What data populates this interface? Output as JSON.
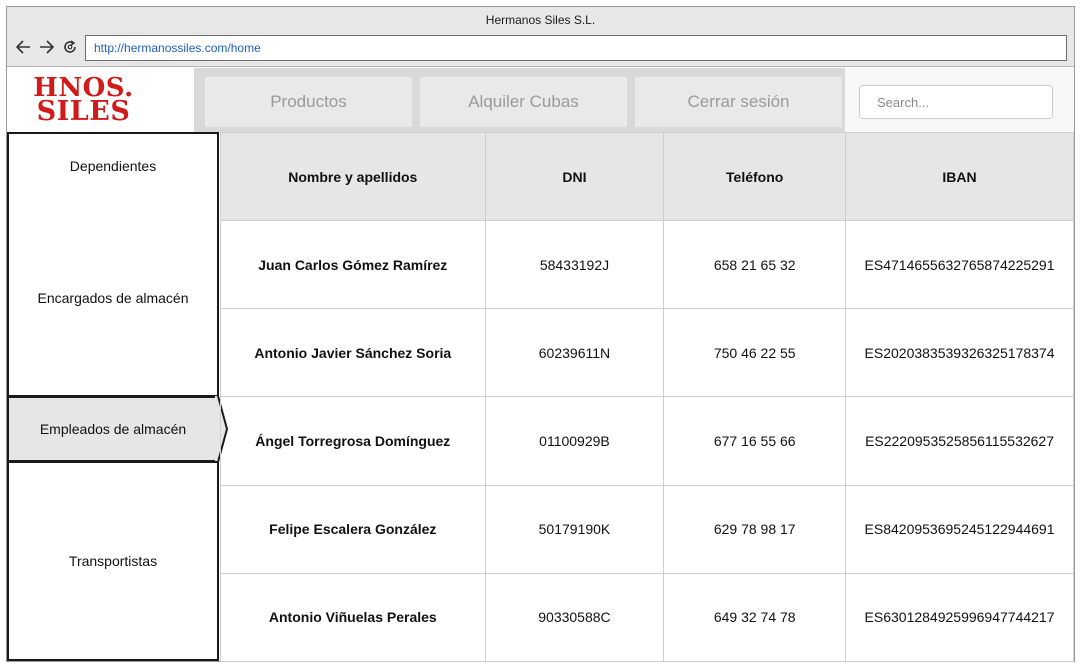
{
  "window": {
    "title": "Hermanos Siles S.L.",
    "url": "http://hermanossiles.com/home"
  },
  "logo": {
    "line1": "HNOS.",
    "line2": "SILES"
  },
  "nav": {
    "items": [
      {
        "label": "Productos"
      },
      {
        "label": "Alquiler Cubas"
      },
      {
        "label": "Cerrar sesión"
      }
    ]
  },
  "search": {
    "placeholder": "Search..."
  },
  "sidebar": {
    "items": [
      {
        "label": "Dependientes"
      },
      {
        "label": "Encargados de almacén"
      },
      {
        "label": "Empleados de almacén"
      },
      {
        "label": "Transportistas"
      }
    ],
    "active": "Empleados de almacén"
  },
  "table": {
    "headers": [
      "Nombre y apellidos",
      "DNI",
      "Teléfono",
      "IBAN"
    ],
    "rows": [
      [
        "Juan Carlos Gómez Ramírez",
        "58433192J",
        "658 21 65 32",
        "ES4714655632765874225291"
      ],
      [
        "Antonio Javier Sánchez Soria",
        "60239611N",
        "750 46 22 55",
        "ES2020383539326325178374"
      ],
      [
        "Ángel Torregrosa Domínguez",
        "01100929B",
        "677 16 55 66",
        "ES2220953525856115532627"
      ],
      [
        "Felipe Escalera González",
        "50179190K",
        "629 78 98 17",
        "ES8420953695245122944691"
      ],
      [
        "Antonio Viñuelas Perales",
        "90330588C",
        "649 32 74 78",
        "ES6301284925996947744217"
      ]
    ]
  },
  "colors": {
    "logo": "#d11b1b",
    "url": "#1f5fbf",
    "menu_text": "#9a9a9a",
    "header_bg": "#e6e6e6"
  }
}
